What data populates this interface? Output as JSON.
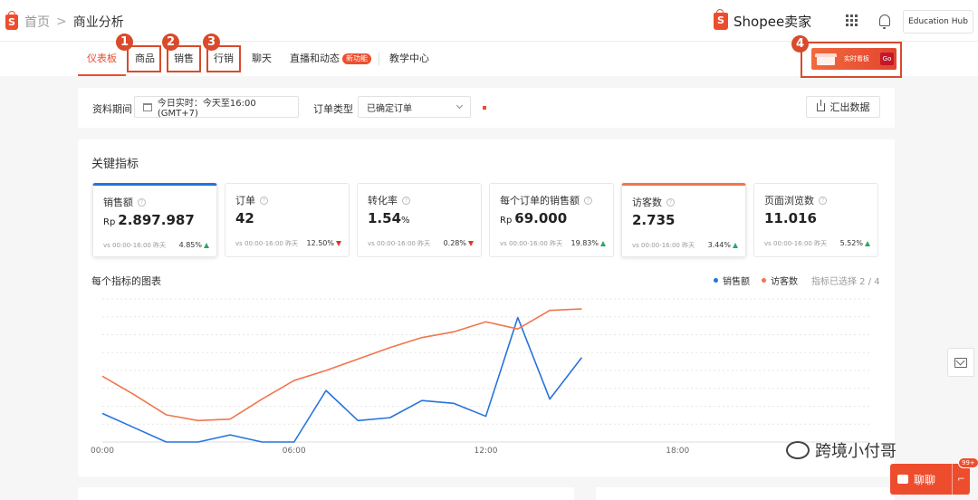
{
  "header": {
    "logo_letter": "S",
    "breadcrumb_home": "首页",
    "breadcrumb_sep": ">",
    "breadcrumb_current": "商业分析",
    "brand": "Shopee卖家",
    "edu_hub": "Education Hub"
  },
  "tabs": [
    {
      "label": "仪表板",
      "active": true
    },
    {
      "label": "商品"
    },
    {
      "label": "销售"
    },
    {
      "label": "行销"
    },
    {
      "label": "聊天"
    },
    {
      "label": "直播和动态",
      "badge": "新功能"
    },
    {
      "label": "教学中心"
    }
  ],
  "annotations": [
    "1",
    "2",
    "3",
    "4"
  ],
  "realtime_banner": {
    "label": "实时看板",
    "go": "Go"
  },
  "filters": {
    "period_label": "资料期间",
    "period_value": "今日实时：今天至16:00 (GMT+7)",
    "order_type_label": "订单类型",
    "order_type_value": "已确定订单",
    "export_label": "汇出数据"
  },
  "key_metrics": {
    "title": "关键指标",
    "items": [
      {
        "name": "销售额",
        "currency": "Rp",
        "value": "2.897.987",
        "compare": "vs 00:00-16:00 昨天",
        "change": "4.85%",
        "dir": "up",
        "selected": "blue"
      },
      {
        "name": "订单",
        "currency": "",
        "value": "42",
        "compare": "vs 00:00-16:00 昨天",
        "change": "12.50%",
        "dir": "down",
        "selected": ""
      },
      {
        "name": "转化率",
        "currency": "",
        "value": "1.54",
        "unit": "%",
        "compare": "vs 00:00-16:00 昨天",
        "change": "0.28%",
        "dir": "down",
        "selected": ""
      },
      {
        "name": "每个订单的销售额",
        "currency": "Rp",
        "value": "69.000",
        "compare": "vs 00:00-16:00 昨天",
        "change": "19.83%",
        "dir": "up",
        "selected": ""
      },
      {
        "name": "访客数",
        "currency": "",
        "value": "2.735",
        "compare": "vs 00:00-16:00 昨天",
        "change": "3.44%",
        "dir": "up",
        "selected": "orange"
      },
      {
        "name": "页面浏览数",
        "currency": "",
        "value": "11.016",
        "compare": "vs 00:00-16:00 昨天",
        "change": "5.52%",
        "dir": "up",
        "selected": ""
      }
    ]
  },
  "chart_section": {
    "title": "每个指标的图表",
    "legend": [
      {
        "name": "销售额",
        "color": "#2673dd"
      },
      {
        "name": "访客数",
        "color": "#f0764d"
      }
    ],
    "selected_text": "指标已选择 2 / 4"
  },
  "chart_data": {
    "type": "line",
    "x_ticks": [
      "00:00",
      "06:00",
      "12:00",
      "18:00"
    ],
    "x_range": [
      0,
      24
    ],
    "y_range": [
      0,
      100
    ],
    "grid": true,
    "series": [
      {
        "name": "销售额",
        "color": "#2673dd",
        "x": [
          0,
          1,
          2,
          3,
          4,
          5,
          6,
          7,
          8,
          9,
          10,
          11,
          12,
          13,
          14,
          15
        ],
        "y": [
          20,
          10,
          0,
          0,
          5,
          0,
          0,
          36,
          15,
          17,
          29,
          27,
          18,
          87,
          30,
          59
        ]
      },
      {
        "name": "访客数",
        "color": "#f0764d",
        "x": [
          0,
          1,
          2,
          3,
          4,
          5,
          6,
          7,
          8,
          9,
          10,
          11,
          12,
          13,
          14,
          15
        ],
        "y": [
          46,
          33,
          19,
          15,
          16,
          30,
          43,
          50,
          58,
          66,
          73,
          77,
          84,
          79,
          92,
          93
        ]
      }
    ]
  },
  "chat": {
    "label": "聊聊",
    "badge": "99+"
  },
  "watermark": "跨境小付哥"
}
